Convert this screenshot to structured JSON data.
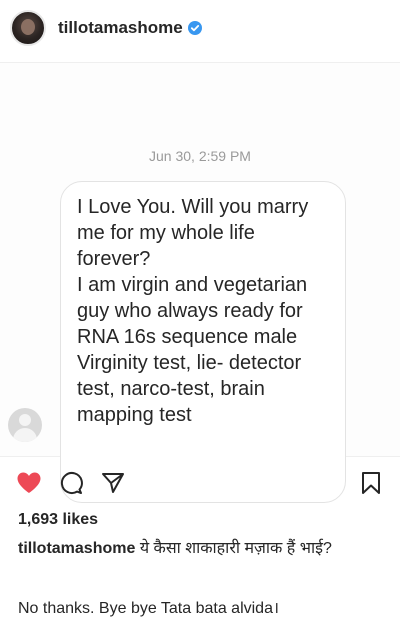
{
  "header": {
    "username": "tillotamashome",
    "verified_icon": "verified-badge-icon",
    "verified_color": "#3897f0"
  },
  "post": {
    "timestamp": "Jun 30, 2:59 PM",
    "message": "I Love You. Will you marry me for my whole life forever?\nI am virgin and vegetarian guy who always ready for RNA 16s sequence male Virginity test, lie- detector test, narco-test, brain mapping test",
    "sender_avatar_icon": "default-avatar-icon"
  },
  "actions": {
    "like_icon": "heart-icon",
    "like_color": "#ed4956",
    "comment_icon": "comment-icon",
    "share_icon": "share-icon",
    "save_icon": "bookmark-icon"
  },
  "likes": "1,693 likes",
  "caption": {
    "username": "tillotamashome",
    "text": "ये कैसा शाकाहारी मज़ाक हैं भाई?",
    "line2": "No thanks. Bye bye Tata bata alvida।"
  }
}
